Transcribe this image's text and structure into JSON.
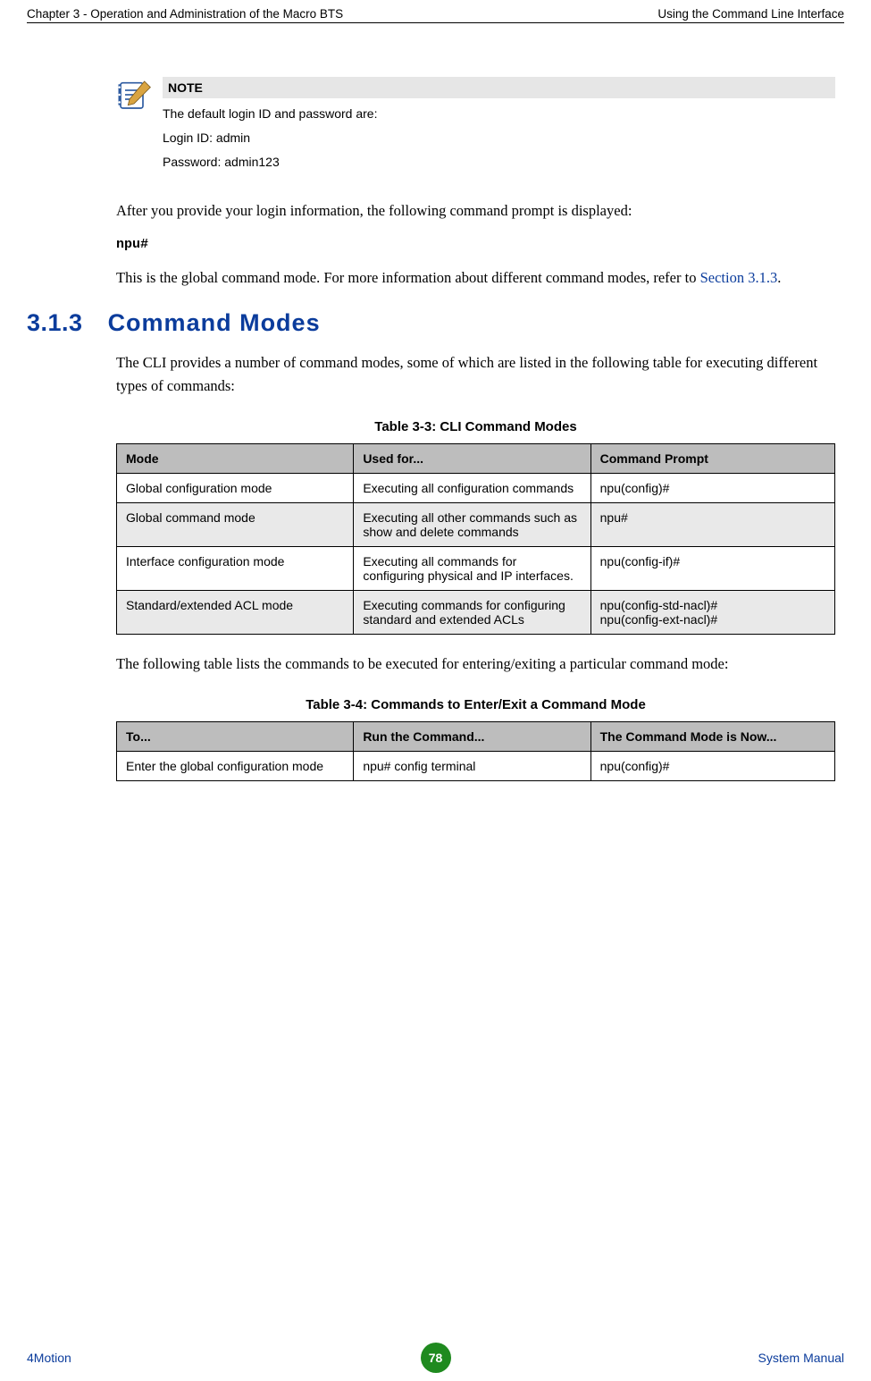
{
  "header": {
    "left": "Chapter 3 - Operation and Administration of the Macro BTS",
    "right": "Using the Command Line Interface"
  },
  "note": {
    "label": "NOTE",
    "lines": [
      "The default login ID and password are:",
      "Login ID: admin",
      "Password: admin123"
    ]
  },
  "para1": "After you provide your login information, the following command prompt is displayed:",
  "prompt1": "npu#",
  "para2a": "This is the global command mode. For more information about different command modes, refer to ",
  "para2b": "Section 3.1.3",
  "para2c": ".",
  "section": {
    "num": "3.1.3",
    "title": "Command Modes"
  },
  "para3": "The CLI provides a number of command modes, some of which are listed in the following table for executing different types of commands:",
  "table33": {
    "caption": "Table 3-3: CLI Command Modes",
    "headers": [
      "Mode",
      "Used for...",
      "Command Prompt"
    ],
    "rows": [
      [
        "Global configuration mode",
        "Executing all configuration commands",
        "npu(config)#"
      ],
      [
        "Global command mode",
        "Executing all other commands such as show and delete commands",
        "npu#"
      ],
      [
        "Interface configuration mode",
        "Executing all commands for configuring physical and IP interfaces.",
        "npu(config-if)#"
      ],
      [
        "Standard/extended ACL mode",
        "Executing commands for configuring standard and extended ACLs",
        "npu(config-std-nacl)#\nnpu(config-ext-nacl)#"
      ]
    ]
  },
  "para4": "The following table lists the commands to be executed for entering/exiting a particular command mode:",
  "table34": {
    "caption": "Table 3-4: Commands to Enter/Exit a Command Mode",
    "headers": [
      "To...",
      "Run the Command...",
      "The Command Mode is Now..."
    ],
    "rows": [
      [
        "Enter the global configuration mode",
        "npu# config terminal",
        "npu(config)#"
      ]
    ]
  },
  "footer": {
    "left": "4Motion",
    "page": "78",
    "right": "System Manual"
  }
}
